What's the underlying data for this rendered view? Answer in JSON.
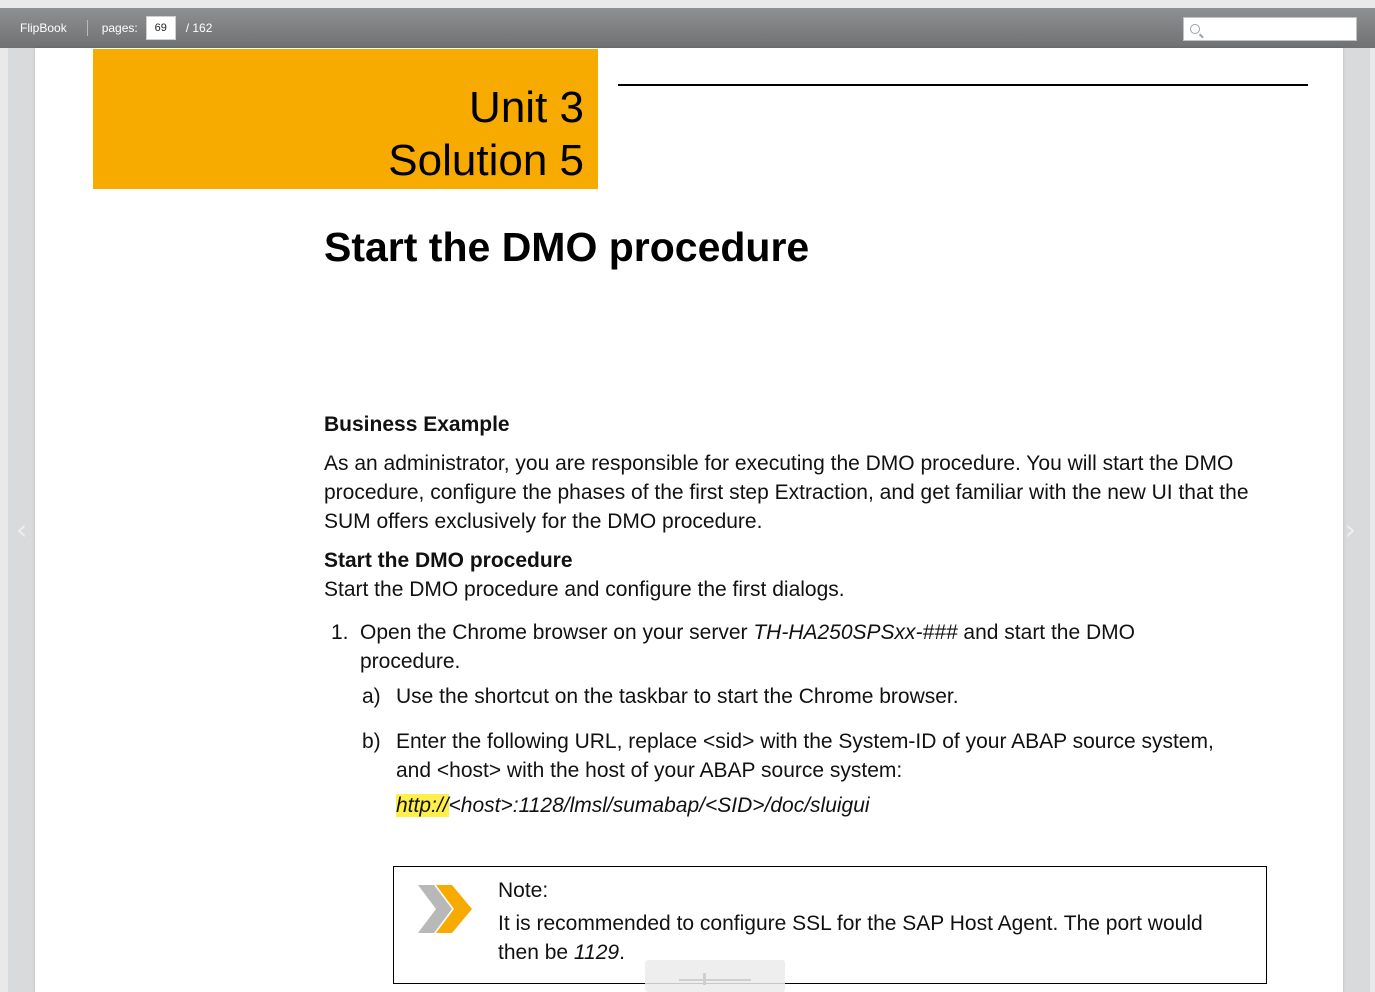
{
  "toolbar": {
    "brand": "FlipBook",
    "pages_label": "pages:",
    "current_page": "69",
    "total_pages": "/ 162",
    "search_placeholder": ""
  },
  "document": {
    "unit_line1": "Unit 3",
    "unit_line2": "Solution 5",
    "title": "Start the DMO procedure",
    "business_example_heading": "Business Example",
    "business_example_text": "As an administrator, you are responsible for executing the DMO procedure. You will start the DMO procedure, configure the phases of the first step Extraction, and get familiar with the new UI that the SUM offers exclusively for the DMO procedure.",
    "section_heading": "Start the DMO procedure",
    "section_intro": "Start the DMO procedure and configure the first dialogs.",
    "step1_number": "1.",
    "step1_text_before": "Open the Chrome browser on your server ",
    "step1_server": "TH-HA250SPSxx-###",
    "step1_text_after": " and start the DMO procedure.",
    "substep_a_letter": "a)",
    "substep_a_text": "Use the shortcut on the taskbar to start the Chrome browser.",
    "substep_b_letter": "b)",
    "substep_b_text": "Enter the following URL, replace <sid> with the System-ID of your ABAP source system, and <host> with the host of your ABAP source system:",
    "url_highlight": "http://",
    "url_rest": "<host>:1128/lmsl/sumabap/<SID>/doc/sluigui",
    "note_title": "Note:",
    "note_text_before": "It is recommended to configure SSL for the SAP Host Agent. The port would then be ",
    "note_port": "1129",
    "note_text_after": "."
  },
  "colors": {
    "unit_block": "#f7ab00",
    "highlight": "#ffef4a",
    "toolbar": "#7f8183"
  },
  "icons": {
    "search": "search-icon",
    "note": "double-chevron-note-icon",
    "prev": "chevron-left-icon",
    "next": "chevron-right-icon"
  }
}
